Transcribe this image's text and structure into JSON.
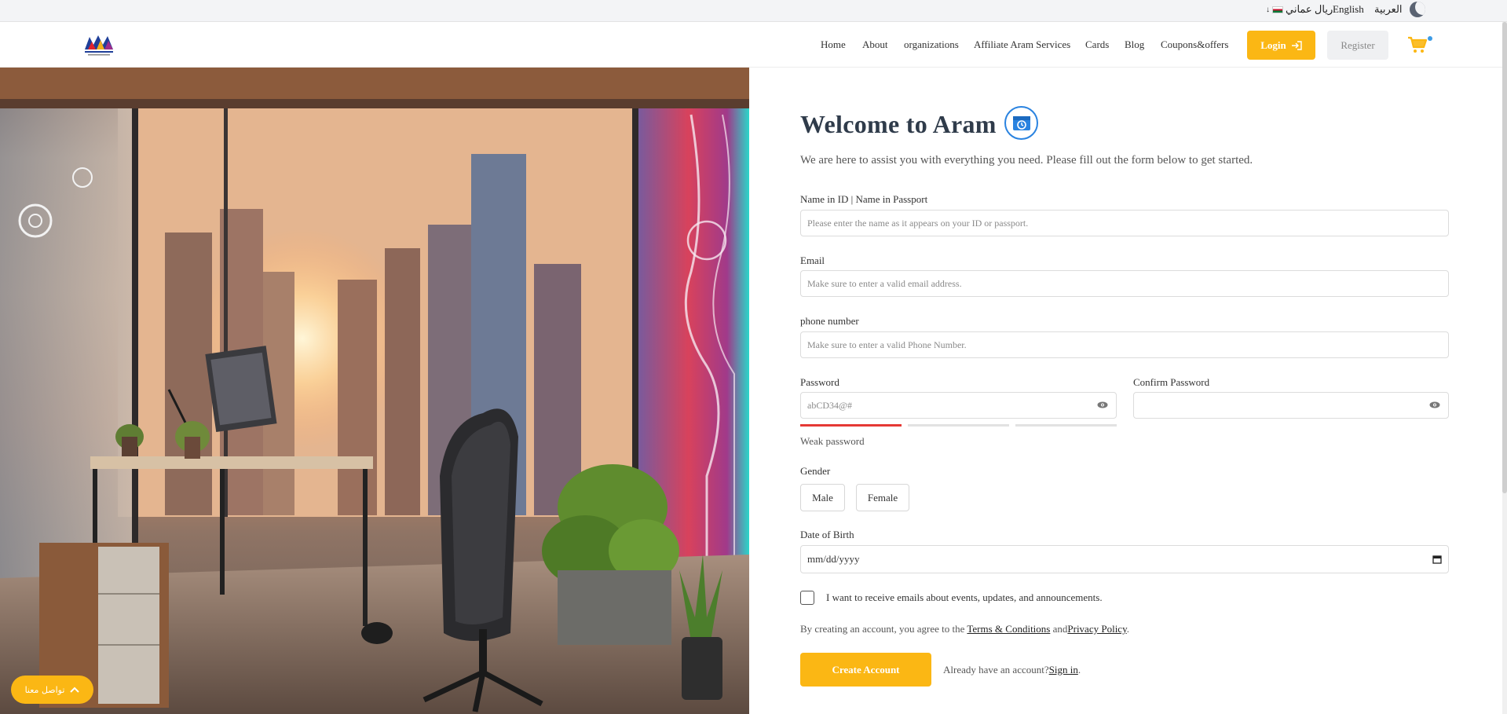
{
  "topbar": {
    "currency": "ريال عماني",
    "english": "English",
    "arabic": "العربية",
    "theme_icon": "moon-icon"
  },
  "nav": {
    "items": [
      "Home",
      "About",
      "organizations",
      "Affiliate Aram Services",
      "Cards",
      "Blog",
      "Coupons&offers"
    ],
    "login": "Login",
    "register": "Register",
    "cart_icon": "cart-icon"
  },
  "colors": {
    "accent": "#fbb714",
    "title": "#2f3b4a",
    "strength_weak": "#e53935",
    "icon_blue": "#2a83e0"
  },
  "form": {
    "title": "Welcome to Aram",
    "subtitle": "We are here to assist you with everything you need. Please fill out the form below to get started.",
    "name_label": "Name in ID | Name in Passport",
    "name_placeholder": "Please enter the name as it appears on your ID or passport.",
    "email_label": "Email",
    "email_placeholder": "Make sure to enter a valid email address.",
    "phone_label": "phone number",
    "phone_placeholder": "Make sure to enter a valid Phone Number.",
    "password_label": "Password",
    "password_placeholder": "abCD34@#",
    "confirm_label": "Confirm Password",
    "confirm_placeholder": "",
    "strength_text": "Weak password",
    "gender_label": "Gender",
    "male": "Male",
    "female": "Female",
    "dob_label": "Date of Birth",
    "dob_placeholder": "mm/dd/yyyy",
    "emails_checkbox": "I want to receive emails about events, updates, and announcements.",
    "terms_prefix": "By creating an account, you agree to the ",
    "terms_link": "Terms & Conditions",
    "terms_and": " and",
    "privacy_link": "Privacy Policy",
    "terms_suffix": ".",
    "create_button": "Create Account",
    "already_text": "Already have an account?",
    "sign_in": "Sign in",
    "sign_in_suffix": "."
  },
  "contact": {
    "label": "تواصل معنا"
  }
}
